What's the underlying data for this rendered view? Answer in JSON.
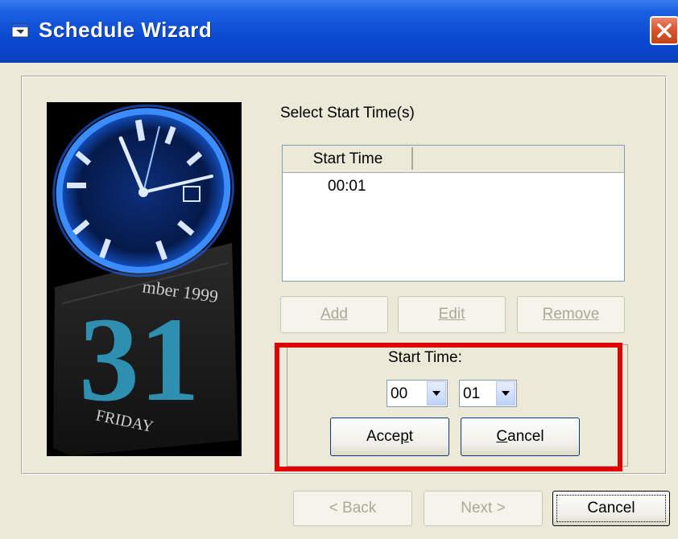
{
  "window": {
    "title": "Schedule Wizard"
  },
  "schedule": {
    "select_label": "Select Start Time(s)",
    "list": {
      "columns": [
        "Start Time",
        ""
      ],
      "rows": [
        "00:01"
      ]
    },
    "buttons": {
      "add": "Add",
      "edit": "Edit",
      "remove": "Remove"
    }
  },
  "editor": {
    "label": "Start Time:",
    "hour": "00",
    "minute": "01",
    "accept_prefix": "Acce",
    "accept_underline": "p",
    "accept_suffix": "t",
    "cancel_underline": "C",
    "cancel_suffix": "ancel"
  },
  "wizard": {
    "back": "< Back",
    "next": "Next >",
    "cancel": "Cancel"
  },
  "picture": {
    "calendar_month_fragment": "mber 1999",
    "calendar_day": "31",
    "calendar_weekday": "FRIDAY"
  },
  "colors": {
    "highlight": "#e00000",
    "titlebar": "#0a4ad2",
    "calendar_digits": "#2f8fb0"
  }
}
